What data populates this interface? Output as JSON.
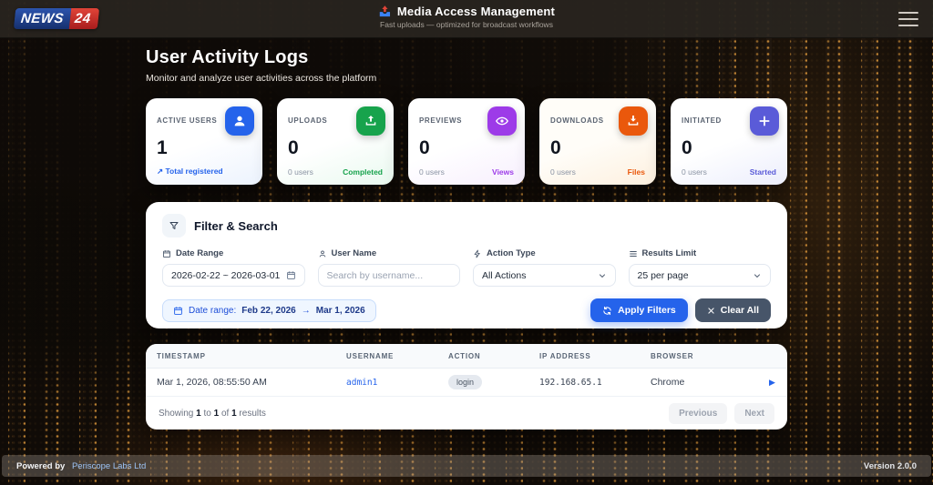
{
  "colors": {
    "accent_blue": "#2563eb",
    "green": "#17a34c",
    "purple": "#9d3be8",
    "orange": "#ea580c",
    "indigo": "#5a5bd8",
    "slate_button": "#475569",
    "chip_bg": "#eff6ff",
    "bokeh_amber": "#ffb246"
  },
  "header": {
    "logo_part1": "NEWS",
    "logo_part2": "24",
    "app_title": "Media Access Management",
    "app_subtitle": "Fast uploads — optimized for broadcast workflows"
  },
  "page": {
    "title": "User Activity Logs",
    "subtitle": "Monitor and analyze user activities across the platform"
  },
  "stats": [
    {
      "label": "ACTIVE USERS",
      "value": "1",
      "footer_left": "↗ Total registered",
      "footer_right": "",
      "icon": "user-icon",
      "color": "#2563eb"
    },
    {
      "label": "UPLOADS",
      "value": "0",
      "footer_left": "0 users",
      "footer_right": "Completed",
      "icon": "upload-icon",
      "color": "#17a34c"
    },
    {
      "label": "PREVIEWS",
      "value": "0",
      "footer_left": "0 users",
      "footer_right": "Views",
      "icon": "eye-icon",
      "color": "#9d3be8"
    },
    {
      "label": "DOWNLOADS",
      "value": "0",
      "footer_left": "0 users",
      "footer_right": "Files",
      "icon": "download-icon",
      "color": "#ea580c"
    },
    {
      "label": "INITIATED",
      "value": "0",
      "footer_left": "0 users",
      "footer_right": "Started",
      "icon": "plus-icon",
      "color": "#5a5bd8"
    }
  ],
  "filter": {
    "title": "Filter & Search",
    "date_range": {
      "label": "Date Range",
      "value": "2026-02-22 ~ 2026-03-01"
    },
    "user_name": {
      "label": "User Name",
      "placeholder": "Search by username..."
    },
    "action_type": {
      "label": "Action Type",
      "value": "All Actions"
    },
    "results_limit": {
      "label": "Results Limit",
      "value": "25 per page"
    },
    "chip": {
      "prefix": "Date range:",
      "from": "Feb 22, 2026",
      "arrow": "→",
      "to": "Mar 1, 2026"
    },
    "apply_label": "Apply Filters",
    "clear_label": "Clear All"
  },
  "table": {
    "headers": [
      "TIMESTAMP",
      "USERNAME",
      "ACTION",
      "IP ADDRESS",
      "BROWSER"
    ],
    "rows": [
      {
        "timestamp": "Mar 1, 2026, 08:55:50 AM",
        "username": "admin1",
        "action": "login",
        "ip": "192.168.65.1",
        "browser": "Chrome"
      }
    ]
  },
  "pagination": {
    "prefix": "Showing",
    "n_from": "1",
    "word_to": "to",
    "n_to": "1",
    "word_of": "of",
    "n_total": "1",
    "suffix": "results",
    "prev_label": "Previous",
    "next_label": "Next"
  },
  "footer": {
    "powered_by": "Powered by",
    "company": "Periscope Labs Ltd",
    "version": "Version 2.0.0"
  }
}
